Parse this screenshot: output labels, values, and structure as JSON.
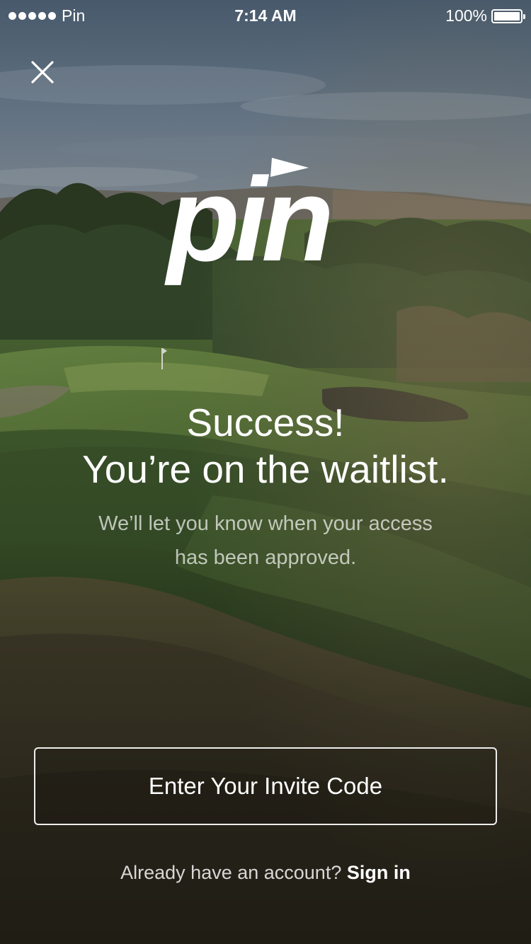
{
  "status_bar": {
    "carrier": "Pin",
    "time": "7:14 AM",
    "battery_percent": "100%",
    "battery_level": 1.0
  },
  "icons": {
    "close": "close-icon",
    "logo": "pin-logo"
  },
  "headline": {
    "line1": "Success!",
    "line2": "You’re on the waitlist."
  },
  "subtext": {
    "line1": "We’ll let you know when your access",
    "line2": "has been approved."
  },
  "invite_button": {
    "label": "Enter Your Invite Code"
  },
  "signin": {
    "prompt": "Already have an account?",
    "link": "Sign in"
  },
  "logo": {
    "text": "pin"
  },
  "colors": {
    "text": "#ffffff",
    "subtext": "rgba(255,255,255,0.68)"
  }
}
